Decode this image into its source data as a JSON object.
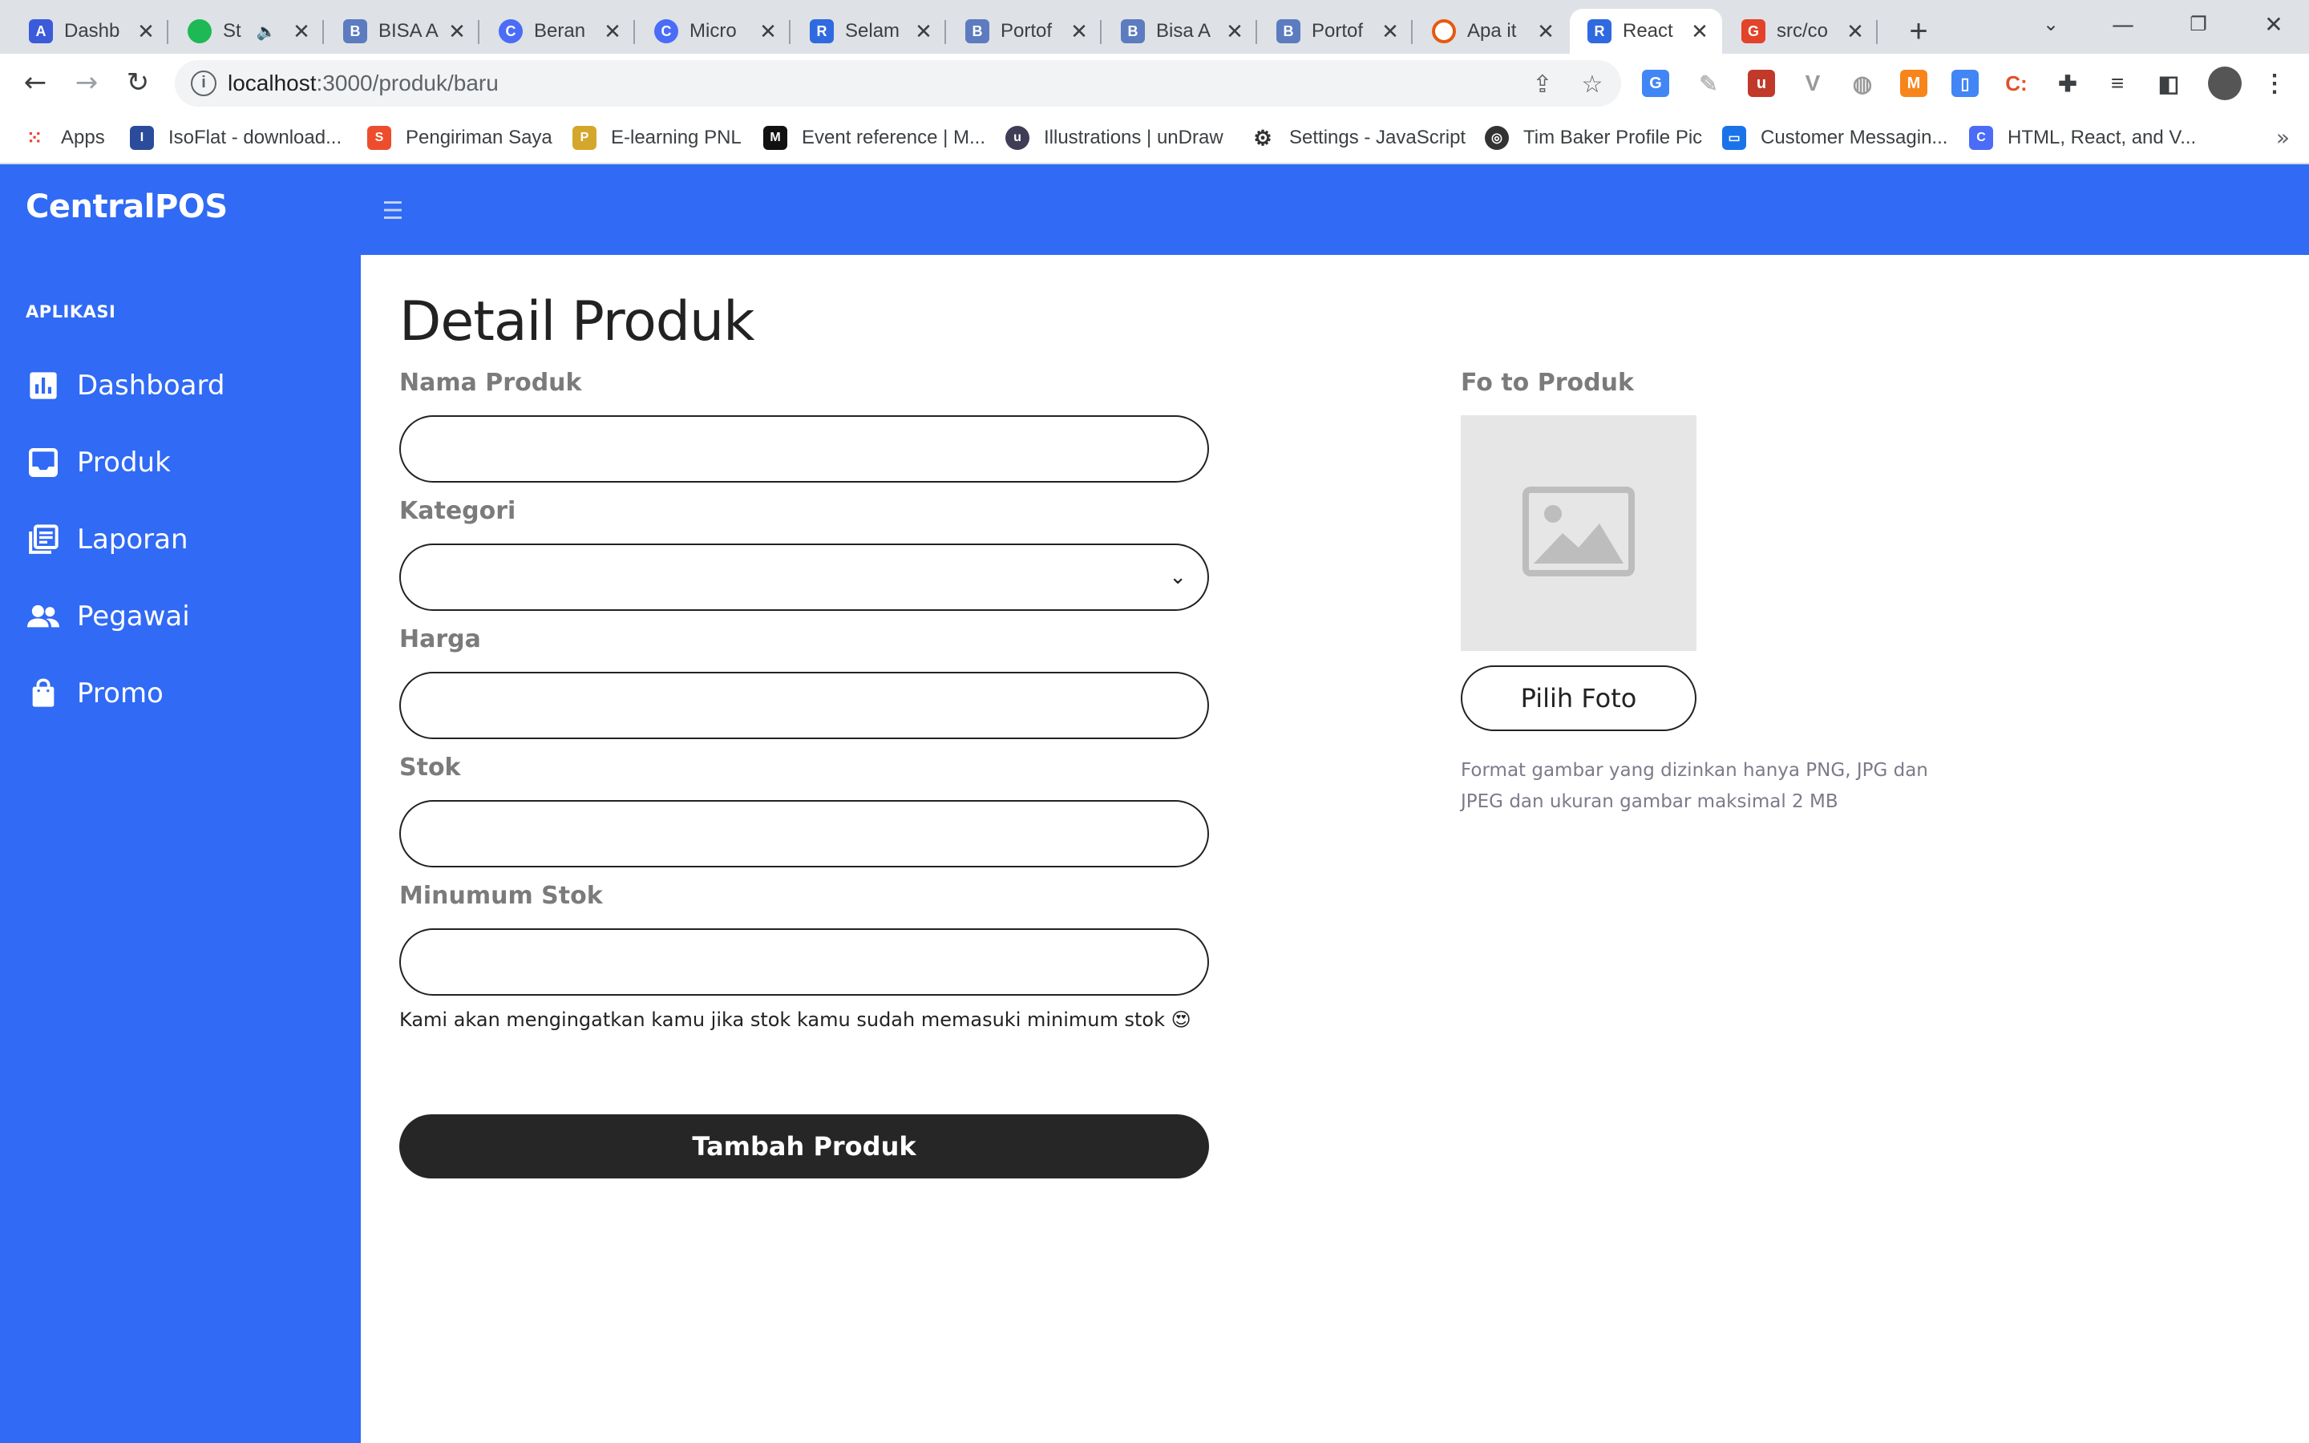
{
  "browser": {
    "tabs": [
      {
        "title": "Dashb",
        "favicon": "app-favicon",
        "color": "#3b5bdb"
      },
      {
        "title": "St",
        "favicon": "spotify-favicon",
        "color": "#1db954"
      },
      {
        "title": "BISA A",
        "favicon": "bisa-favicon",
        "color": "#5c7cbf"
      },
      {
        "title": "Beran",
        "favicon": "c-favicon",
        "color": "#4a6cf7"
      },
      {
        "title": "Micro",
        "favicon": "c-favicon",
        "color": "#4a6cf7"
      },
      {
        "title": "Selam",
        "favicon": "react-favicon",
        "color": "#2f6ae0"
      },
      {
        "title": "Portof",
        "favicon": "bisa-favicon",
        "color": "#5c7cbf"
      },
      {
        "title": "Bisa A",
        "favicon": "bisa-favicon",
        "color": "#5c7cbf"
      },
      {
        "title": "Portof",
        "favicon": "bisa-favicon",
        "color": "#5c7cbf"
      },
      {
        "title": "Apa it",
        "favicon": "circle-favicon",
        "color": "#e8590c"
      },
      {
        "title": "React",
        "favicon": "react-favicon",
        "color": "#2f6ae0"
      },
      {
        "title": "src/co",
        "favicon": "gitlab-favicon",
        "color": "#e24329"
      }
    ],
    "url_host": "localhost",
    "url_path": ":3000/produk/baru",
    "bookmarks": [
      {
        "label": "Apps",
        "icon": "apps-grid-icon",
        "color": "#ea4335"
      },
      {
        "label": "IsoFlat - download...",
        "icon": "isoflat-icon",
        "color": "#2b4c9b"
      },
      {
        "label": "Pengiriman Saya",
        "icon": "shopee-icon",
        "color": "#ee4d2d"
      },
      {
        "label": "E-learning PNL",
        "icon": "pnl-icon",
        "color": "#d4a72c"
      },
      {
        "label": "Event reference | M...",
        "icon": "mdn-icon",
        "color": "#111111"
      },
      {
        "label": "Illustrations | unDraw",
        "icon": "undraw-icon",
        "color": "#3f3d56"
      },
      {
        "label": "Settings - JavaScript",
        "icon": "gear-icon",
        "color": "#333333"
      },
      {
        "label": "Tim Baker Profile Pic",
        "icon": "globe-icon",
        "color": "#333333"
      },
      {
        "label": "Customer Messagin...",
        "icon": "messaging-icon",
        "color": "#1a73e8"
      },
      {
        "label": "HTML, React, and V...",
        "icon": "c-icon",
        "color": "#4a6cf7"
      }
    ]
  },
  "app": {
    "brand": "CentralPOS",
    "section_label": "APLIKASI",
    "nav": [
      {
        "label": "Dashboard",
        "icon": "chart-icon"
      },
      {
        "label": "Produk",
        "icon": "inbox-icon"
      },
      {
        "label": "Laporan",
        "icon": "report-icon"
      },
      {
        "label": "Pegawai",
        "icon": "people-icon"
      },
      {
        "label": "Promo",
        "icon": "bag-icon"
      }
    ],
    "colors": {
      "primary": "#306af5",
      "dark_button": "#262626"
    }
  },
  "page": {
    "title": "Detail Produk",
    "fields": {
      "nama_produk": {
        "label": "Nama Produk",
        "value": ""
      },
      "kategori": {
        "label": "Kategori",
        "value": ""
      },
      "harga": {
        "label": "Harga",
        "value": ""
      },
      "stok": {
        "label": "Stok",
        "value": ""
      },
      "minimum_stok": {
        "label": "Minumum Stok",
        "value": ""
      }
    },
    "hint": "Kami akan mengingatkan kamu jika stok kamu sudah memasuki minimum stok 😍",
    "submit_label": "Tambah Produk",
    "photo": {
      "label": "Fo to Produk",
      "button_label": "Pilih Foto",
      "note": "Format gambar yang dizinkan hanya PNG, JPG dan JPEG dan ukuran gambar maksimal 2 MB"
    }
  }
}
